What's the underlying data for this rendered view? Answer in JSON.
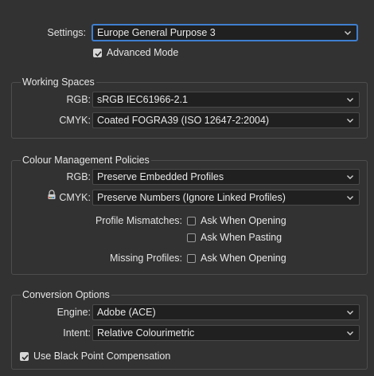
{
  "settings": {
    "label": "Settings:",
    "value": "Europe General Purpose 3",
    "advanced_mode_label": "Advanced Mode",
    "advanced_mode_checked": true
  },
  "working_spaces": {
    "title": "Working Spaces",
    "rgb_label": "RGB:",
    "rgb_value": "sRGB IEC61966-2.1",
    "cmyk_label": "CMYK:",
    "cmyk_value": "Coated FOGRA39 (ISO 12647-2:2004)"
  },
  "policies": {
    "title": "Colour Management Policies",
    "rgb_label": "RGB:",
    "rgb_value": "Preserve Embedded Profiles",
    "cmyk_label": "CMYK:",
    "cmyk_value": "Preserve Numbers (Ignore Linked Profiles)",
    "profile_mismatches_label": "Profile Mismatches:",
    "ask_when_opening_label": "Ask When Opening",
    "ask_when_pasting_label": "Ask When Pasting",
    "missing_profiles_label": "Missing Profiles:",
    "missing_ask_when_opening_label": "Ask When Opening"
  },
  "conversion": {
    "title": "Conversion Options",
    "engine_label": "Engine:",
    "engine_value": "Adobe (ACE)",
    "intent_label": "Intent:",
    "intent_value": "Relative Colourimetric",
    "black_point_label": "Use Black Point Compensation",
    "black_point_checked": true
  },
  "icons": {
    "dropdown": "chevron-down-icon",
    "checkbox_check": "checkmark-icon",
    "lock": "lock-icon"
  },
  "colors": {
    "background": "#323232",
    "focus": "#3f7fd0",
    "field": "#202020"
  }
}
